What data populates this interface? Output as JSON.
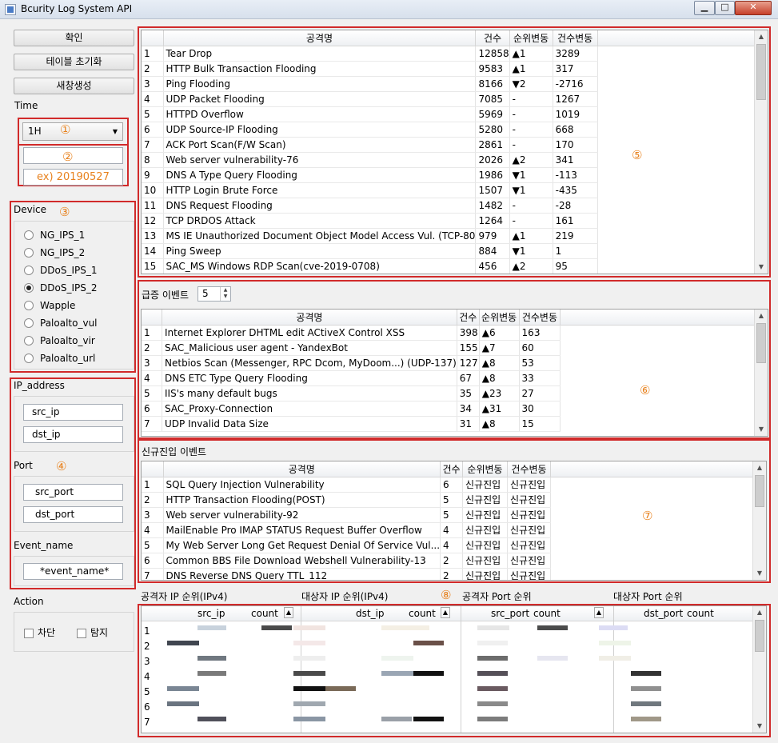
{
  "window": {
    "title": "Bcurity Log System API"
  },
  "left": {
    "confirm_button": "확인",
    "reset_table_button": "테이블 초기화",
    "new_window_button": "새창생성",
    "time_label": "Time",
    "time_select": "1H",
    "date_value": "",
    "date_placeholder": "ex) 20190527",
    "device_label": "Device",
    "devices": [
      "NG_IPS_1",
      "NG_IPS_2",
      "DDoS_IPS_1",
      "DDoS_IPS_2",
      "Wapple",
      "Paloalto_vul",
      "Paloalto_vir",
      "Paloalto_url"
    ],
    "device_selected": "DDoS_IPS_2",
    "ip_label": "IP_address",
    "src_ip": "src_ip",
    "dst_ip": "dst_ip",
    "port_label": "Port",
    "src_port": "src_port",
    "dst_port": "dst_port",
    "event_label": "Event_name",
    "event_name": "*event_name*",
    "action_label": "Action",
    "block_label": "차단",
    "detect_label": "탐지"
  },
  "markers": [
    "①",
    "②",
    "③",
    "④",
    "⑤",
    "⑥",
    "⑦",
    "⑧"
  ],
  "top_table": {
    "headers": [
      "공격명",
      "건수",
      "순위변동",
      "건수변동"
    ],
    "rows": [
      [
        "1",
        "Tear Drop",
        "12858",
        "▲1",
        "3289"
      ],
      [
        "2",
        "HTTP Bulk Transaction Flooding",
        "9583",
        "▲1",
        "317"
      ],
      [
        "3",
        "Ping Flooding",
        "8166",
        "▼2",
        "-2716"
      ],
      [
        "4",
        "UDP Packet Flooding",
        "7085",
        "-",
        "1267"
      ],
      [
        "5",
        "HTTPD Overflow",
        "5969",
        "-",
        "1019"
      ],
      [
        "6",
        "UDP Source-IP Flooding",
        "5280",
        "-",
        "668"
      ],
      [
        "7",
        "ACK Port Scan(F/W Scan)",
        "2861",
        "-",
        "170"
      ],
      [
        "8",
        "Web server vulnerability-76",
        "2026",
        "▲2",
        "341"
      ],
      [
        "9",
        "DNS A Type Query Flooding",
        "1986",
        "▼1",
        "-113"
      ],
      [
        "10",
        "HTTP Login Brute Force",
        "1507",
        "▼1",
        "-435"
      ],
      [
        "11",
        "DNS Request Flooding",
        "1482",
        "-",
        "-28"
      ],
      [
        "12",
        "TCP DRDOS Attack",
        "1264",
        "-",
        "161"
      ],
      [
        "13",
        "MS IE Unauthorized Document Object Model Access Vul. (TCP-80",
        "979",
        "▲1",
        "219"
      ],
      [
        "14",
        "Ping Sweep",
        "884",
        "▼1",
        "1"
      ],
      [
        "15",
        "SAC_MS Windows RDP Scan(cve-2019-0708)",
        "456",
        "▲2",
        "95"
      ]
    ]
  },
  "surge": {
    "label": "급증 이벤트",
    "spin_value": "5",
    "headers": [
      "공격명",
      "건수",
      "순위변동",
      "건수변동"
    ],
    "rows": [
      [
        "1",
        "Internet Explorer DHTML edit ACtiveX Control XSS",
        "398",
        "▲6",
        "163"
      ],
      [
        "2",
        "SAC_Malicious user agent - YandexBot",
        "155",
        "▲7",
        "60"
      ],
      [
        "3",
        "Netbios Scan (Messenger, RPC Dcom, MyDoom...) (UDP-137)",
        "127",
        "▲8",
        "53"
      ],
      [
        "4",
        "DNS ETC Type Query Flooding",
        "67",
        "▲8",
        "33"
      ],
      [
        "5",
        "IIS's many default bugs",
        "35",
        "▲23",
        "27"
      ],
      [
        "6",
        "SAC_Proxy-Connection",
        "34",
        "▲31",
        "30"
      ],
      [
        "7",
        "UDP Invalid Data Size",
        "31",
        "▲8",
        "15"
      ]
    ]
  },
  "new_entry": {
    "label": "신규진입 이벤트",
    "headers": [
      "공격명",
      "건수",
      "순위변동",
      "건수변동"
    ],
    "rows": [
      [
        "1",
        "SQL Query Injection Vulnerability",
        "6",
        "신규진입",
        "신규진입"
      ],
      [
        "2",
        "HTTP Transaction Flooding(POST)",
        "5",
        "신규진입",
        "신규진입"
      ],
      [
        "3",
        "Web server vulnerability-92",
        "5",
        "신규진입",
        "신규진입"
      ],
      [
        "4",
        "MailEnable Pro IMAP STATUS Request Buffer Overflow",
        "4",
        "신규진입",
        "신규진입"
      ],
      [
        "5",
        "My Web Server Long Get Request Denial Of Service Vul...",
        "4",
        "신규진입",
        "신규진입"
      ],
      [
        "6",
        "Common BBS File Download Webshell Vulnerability-13",
        "2",
        "신규진입",
        "신규진입"
      ],
      [
        "7",
        "DNS Reverse DNS Query TTL_112",
        "2",
        "신규진입",
        "신규진입"
      ]
    ]
  },
  "ranking": {
    "attacker_ip_label": "공격자 IP 순위(IPv4)",
    "target_ip_label": "대상자 IP 순위(IPv4)",
    "attacker_port_label": "공격자 Port 순위",
    "target_port_label": "대상자 Port 순위",
    "headers": [
      "src_ip",
      "count",
      "dst_ip",
      "count",
      "src_port",
      "count",
      "dst_port",
      "count"
    ],
    "row_numbers": [
      "1",
      "2",
      "3",
      "4",
      "5",
      "6",
      "7"
    ]
  }
}
